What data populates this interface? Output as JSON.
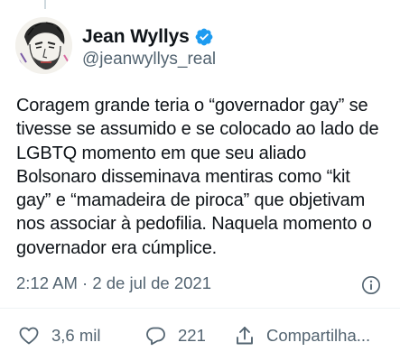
{
  "tweet": {
    "author": {
      "display_name": "Jean Wyllys",
      "handle": "@jeanwyllys_real",
      "verified": true,
      "verified_color": "#1d9bf0"
    },
    "text": "Coragem grande teria o “governador gay” se\ntivesse se assumido e se colocado ao lado de\nLGBTQ momento em que seu aliado\nBolsonaro disseminava mentiras como “kit\ngay” e “mamadeira de piroca” que objetivam\nnos associar à pedofilia. Naquela momento o\ngovernador era cúmplice.",
    "timestamp": "2:12 AM · 2 de jul de 2021"
  },
  "actions": {
    "likes": "3,6 mil",
    "replies": "221",
    "share_label": "Compartilha..."
  },
  "icons": {
    "verified": "verified-badge-icon",
    "info": "info-icon",
    "like": "heart-icon",
    "reply": "speech-bubble-icon",
    "share": "share-icon"
  },
  "colors": {
    "text": "#0f1419",
    "secondary": "#536471",
    "accent": "#1d9bf0"
  }
}
